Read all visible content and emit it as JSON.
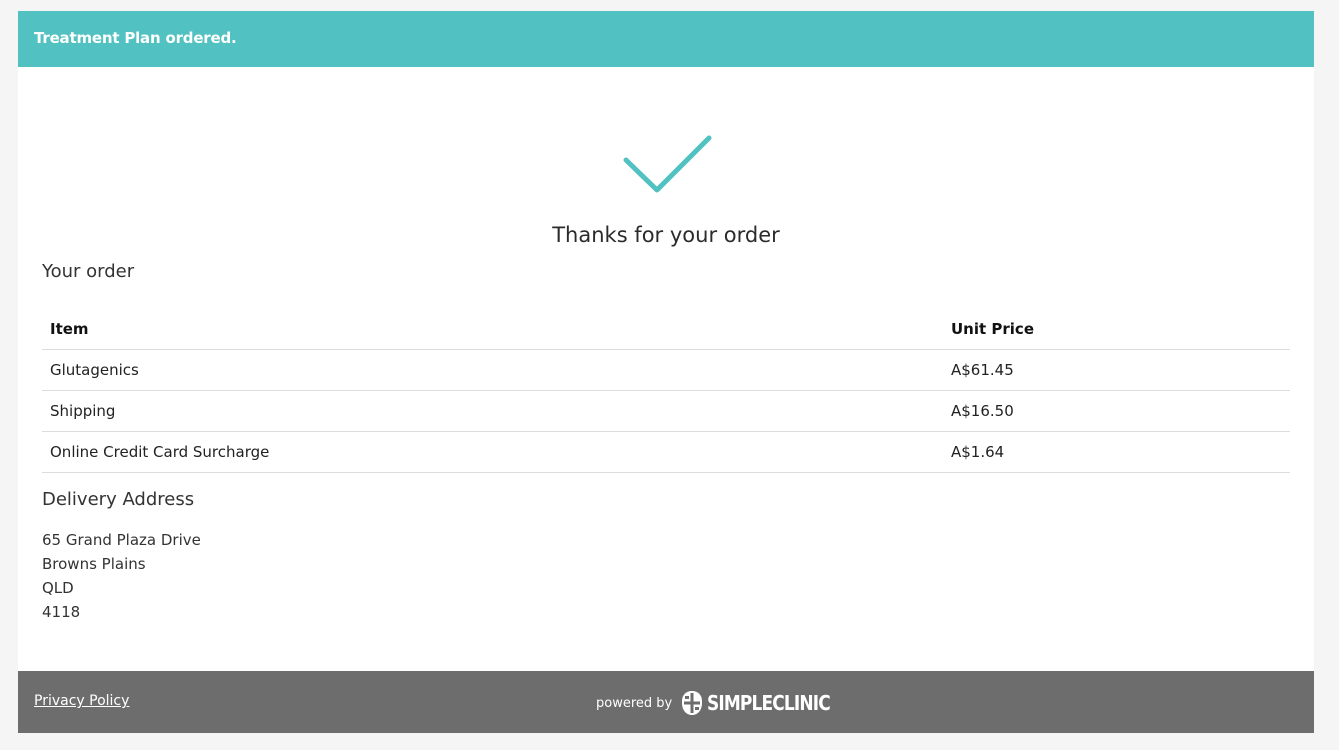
{
  "banner": {
    "message": "Treatment Plan ordered."
  },
  "confirmation": {
    "icon": "check-icon",
    "accent_color": "#52c1c1",
    "heading": "Thanks for your order"
  },
  "order": {
    "title": "Your order",
    "columns": [
      "Item",
      "Unit Price"
    ],
    "rows": [
      {
        "item": "Glutagenics",
        "price": "A$61.45"
      },
      {
        "item": "Shipping",
        "price": "A$16.50"
      },
      {
        "item": "Online Credit Card Surcharge",
        "price": "A$1.64"
      }
    ]
  },
  "delivery": {
    "title": "Delivery Address",
    "lines": [
      "65 Grand Plaza Drive",
      "Browns Plains",
      "QLD",
      "4118"
    ]
  },
  "footer": {
    "privacy_link": "Privacy Policy",
    "powered_by": "powered by",
    "brand": "SIMPLECLINIC",
    "brand_icon": "simpleclinic-logo-icon",
    "background_color": "#6d6d6d"
  }
}
